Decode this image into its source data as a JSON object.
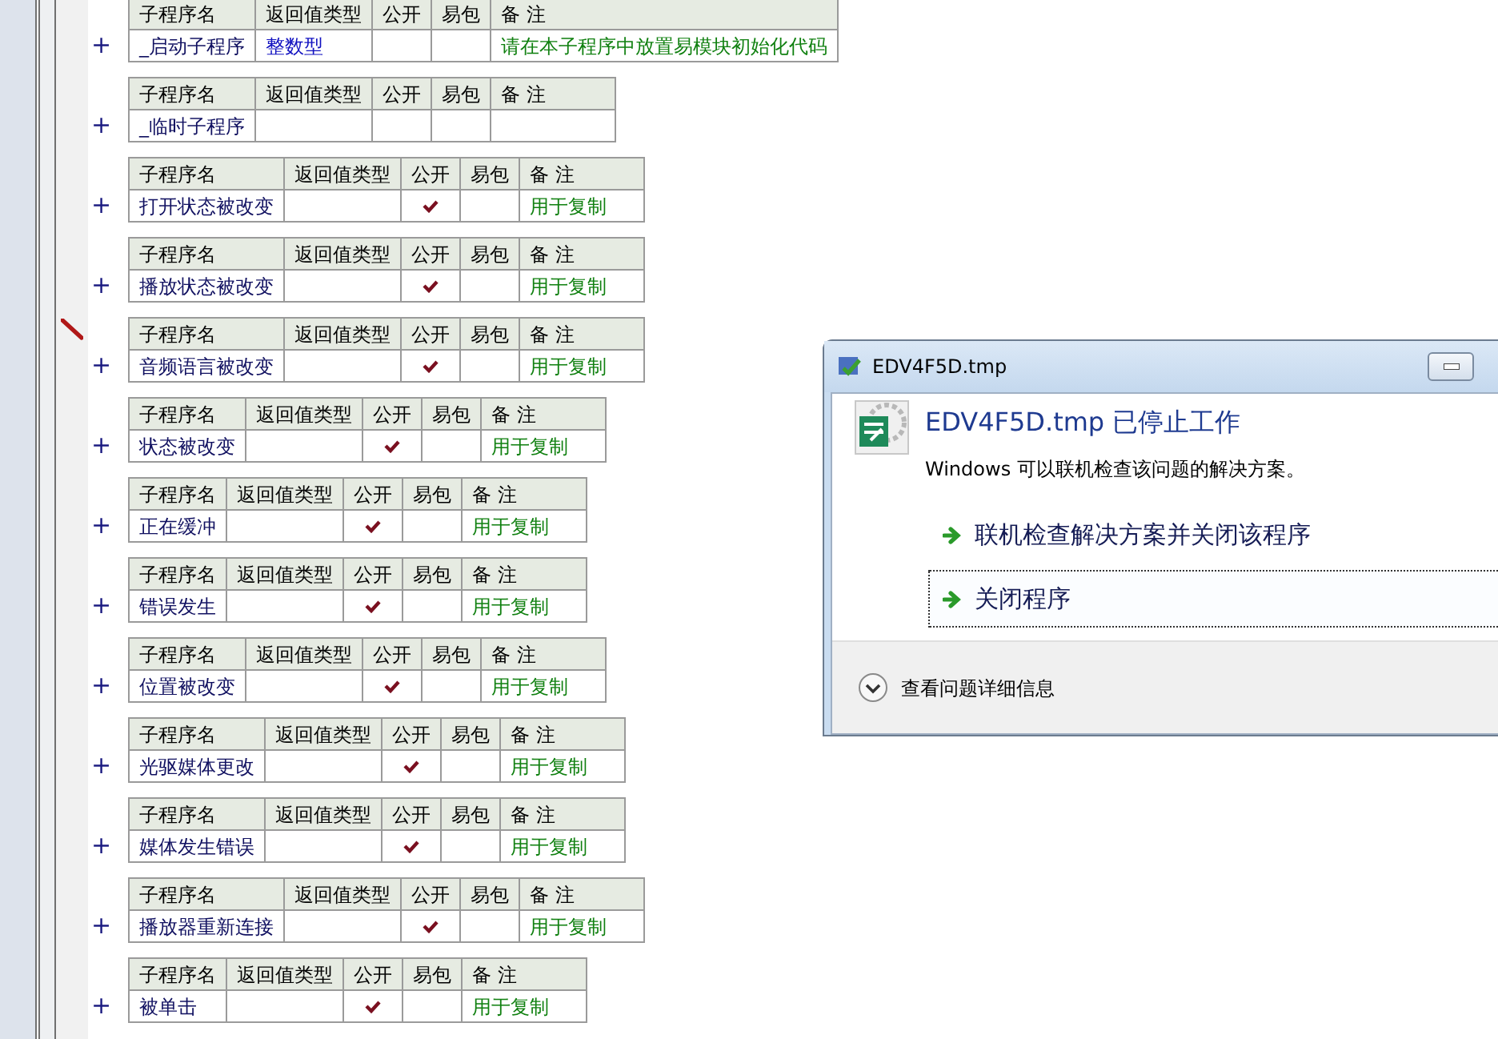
{
  "subroutines": [
    {
      "expander": "+",
      "editing": false,
      "columns": [
        "子程序名",
        "返回值类型",
        "公开",
        "易包",
        "备 注"
      ],
      "name": "_启动子程序",
      "return_type": "整数型",
      "public": false,
      "package": false,
      "remark": "请在本子程序中放置易模块初始化代码"
    },
    {
      "expander": "+",
      "editing": false,
      "columns": [
        "子程序名",
        "返回值类型",
        "公开",
        "易包",
        "备 注"
      ],
      "name": "_临时子程序",
      "public": false,
      "package": false
    },
    {
      "expander": "+",
      "editing": false,
      "columns": [
        "子程序名",
        "返回值类型",
        "公开",
        "易包",
        "备 注"
      ],
      "name": "打开状态被改变",
      "public": true,
      "package": false,
      "remark": "用于复制"
    },
    {
      "expander": "+",
      "editing": false,
      "columns": [
        "子程序名",
        "返回值类型",
        "公开",
        "易包",
        "备 注"
      ],
      "name": "播放状态被改变",
      "public": true,
      "package": false,
      "remark": "用于复制"
    },
    {
      "expander": "+",
      "editing": true,
      "columns": [
        "子程序名",
        "返回值类型",
        "公开",
        "易包",
        "备 注"
      ],
      "name": "音频语言被改变",
      "public": true,
      "package": false,
      "remark": "用于复制"
    },
    {
      "expander": "+",
      "editing": false,
      "columns": [
        "子程序名",
        "返回值类型",
        "公开",
        "易包",
        "备 注"
      ],
      "name": "状态被改变",
      "public": true,
      "package": false,
      "remark": "用于复制"
    },
    {
      "expander": "+",
      "editing": false,
      "columns": [
        "子程序名",
        "返回值类型",
        "公开",
        "易包",
        "备 注"
      ],
      "name": "正在缓冲",
      "public": true,
      "package": false,
      "remark": "用于复制"
    },
    {
      "expander": "+",
      "editing": false,
      "columns": [
        "子程序名",
        "返回值类型",
        "公开",
        "易包",
        "备 注"
      ],
      "name": "错误发生",
      "public": true,
      "package": false,
      "remark": "用于复制"
    },
    {
      "expander": "+",
      "editing": false,
      "columns": [
        "子程序名",
        "返回值类型",
        "公开",
        "易包",
        "备 注"
      ],
      "name": "位置被改变",
      "public": true,
      "package": false,
      "remark": "用于复制"
    },
    {
      "expander": "+",
      "editing": false,
      "columns": [
        "子程序名",
        "返回值类型",
        "公开",
        "易包",
        "备 注"
      ],
      "name": "光驱媒体更改",
      "public": true,
      "package": false,
      "remark": "用于复制"
    },
    {
      "expander": "+",
      "editing": false,
      "columns": [
        "子程序名",
        "返回值类型",
        "公开",
        "易包",
        "备 注"
      ],
      "name": "媒体发生错误",
      "public": true,
      "package": false,
      "remark": "用于复制"
    },
    {
      "expander": "+",
      "editing": false,
      "columns": [
        "子程序名",
        "返回值类型",
        "公开",
        "易包",
        "备 注"
      ],
      "name": "播放器重新连接",
      "public": true,
      "package": false,
      "remark": "用于复制"
    },
    {
      "expander": "+",
      "editing": false,
      "columns": [
        "子程序名",
        "返回值类型",
        "公开",
        "易包",
        "备 注"
      ],
      "name": "被单击",
      "public": true,
      "package": false,
      "remark": "用于复制"
    }
  ],
  "dialog": {
    "title": "EDV4F5D.tmp",
    "heading": "EDV4F5D.tmp 已停止工作",
    "message": "Windows 可以联机检查该问题的解决方案。",
    "options": [
      {
        "label": "联机检查解决方案并关闭该程序",
        "focused": false
      },
      {
        "label": "关闭程序",
        "focused": true
      }
    ],
    "details": "查看问题详细信息"
  }
}
